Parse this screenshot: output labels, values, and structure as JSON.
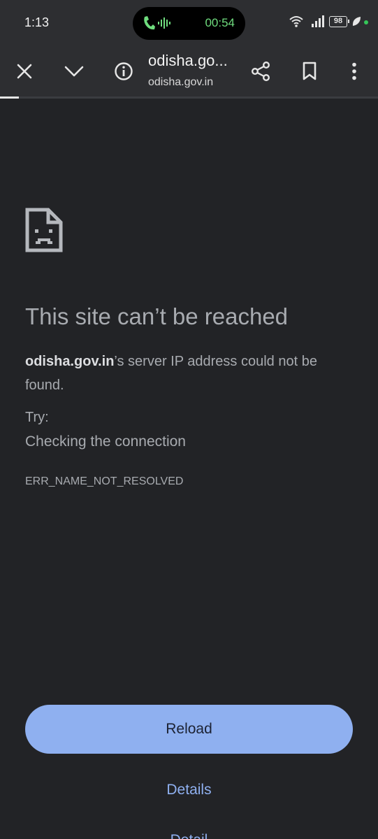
{
  "status_bar": {
    "time": "1:13",
    "call_timer": "00:54",
    "battery": "98"
  },
  "toolbar": {
    "page_title": "odisha.go...",
    "host": "odisha.gov.in",
    "load_progress_percent": 5
  },
  "error": {
    "title": "This site can’t be reached",
    "domain": "odisha.gov.in",
    "message_tail": "’s server IP address could not be found.",
    "try_label": "Try:",
    "suggestion": "Checking the connection",
    "code": "ERR_NAME_NOT_RESOLVED"
  },
  "actions": {
    "reload_label": "Reload",
    "details_label": "Details",
    "details_ghost_label": "Detail"
  }
}
